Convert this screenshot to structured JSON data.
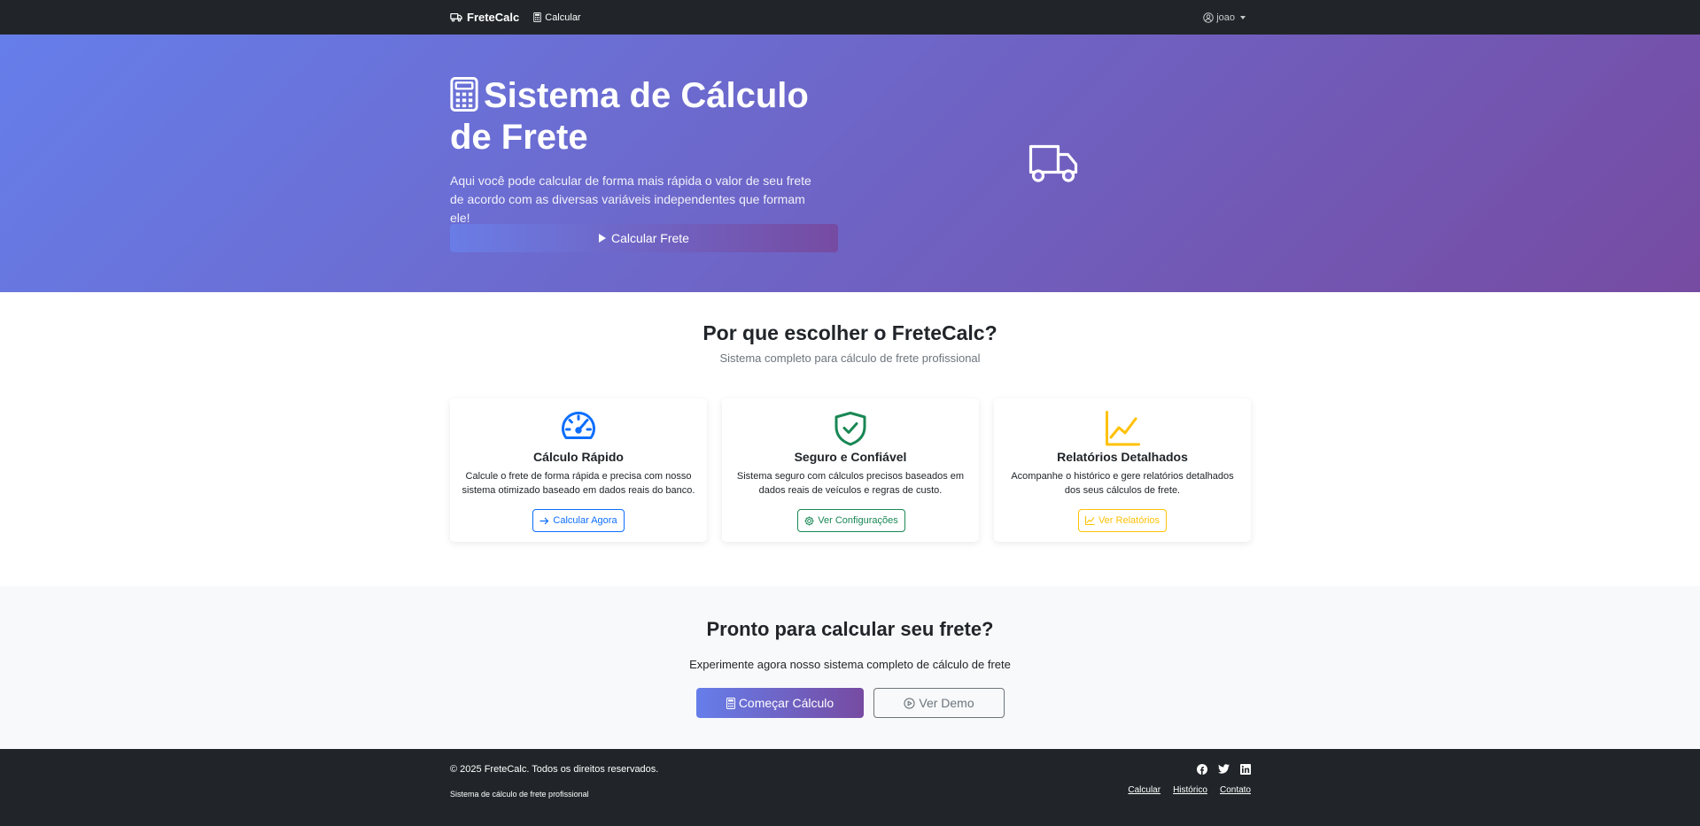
{
  "navbar": {
    "brand": "FreteCalc",
    "links": [
      {
        "label": "Calcular"
      }
    ],
    "user": "joao"
  },
  "hero": {
    "title": "Sistema de Cálculo de Frete",
    "description": "Aqui você pode calcular de forma mais rápida o valor de seu frete de acordo com as diversas variáveis independentes que formam ele!",
    "button_label": "Calcular Frete"
  },
  "features": {
    "title": "Por que escolher o FreteCalc?",
    "subtitle": "Sistema completo para cálculo de frete profissional",
    "cards": [
      {
        "icon": "speedometer-icon",
        "title": "Cálculo Rápido",
        "text": "Calcule o frete de forma rápida e precisa com nosso sistema otimizado baseado em dados reais do banco.",
        "button_label": "Calcular Agora",
        "color": "#0d6efd"
      },
      {
        "icon": "shield-check-icon",
        "title": "Seguro e Confiável",
        "text": "Sistema seguro com cálculos precisos baseados em dados reais de veículos e regras de custo.",
        "button_label": "Ver Configurações",
        "color": "#198754"
      },
      {
        "icon": "graph-up-icon",
        "title": "Relatórios Detalhados",
        "text": "Acompanhe o histórico e gere relatórios detalhados dos seus cálculos de frete.",
        "button_label": "Ver Relatórios",
        "color": "#ffc107"
      }
    ]
  },
  "cta": {
    "title": "Pronto para calcular seu frete?",
    "subtitle": "Experimente agora nosso sistema completo de cálculo de frete",
    "primary_label": "Começar Cálculo",
    "secondary_label": "Ver Demo"
  },
  "footer": {
    "copyright": "© 2025 FreteCalc. Todos os direitos reservados.",
    "tagline": "Sistema de cálculo de frete profissional",
    "social": [
      "facebook-icon",
      "twitter-icon",
      "linkedin-icon"
    ],
    "links": [
      {
        "label": "Calcular"
      },
      {
        "label": "Histórico"
      },
      {
        "label": "Contato"
      }
    ]
  },
  "colors": {
    "navbar_bg": "#212529",
    "gradient_start": "#667eea",
    "gradient_end": "#764ba2",
    "cta_bg": "#f8f9fa"
  }
}
